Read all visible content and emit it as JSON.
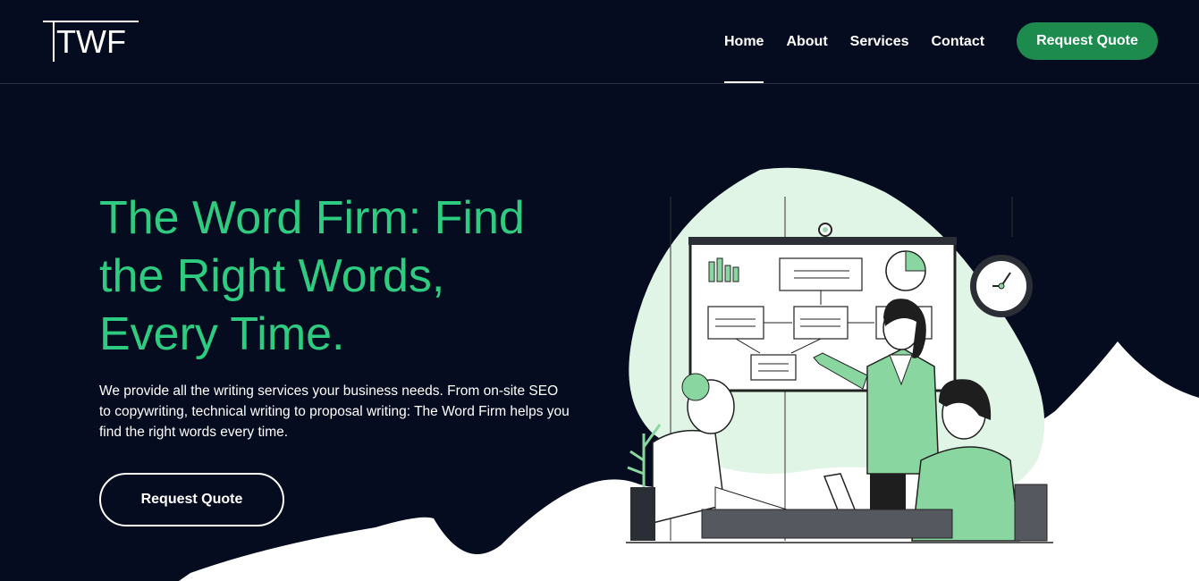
{
  "brand": {
    "logo_text": "TWF"
  },
  "nav": {
    "items": [
      {
        "label": "Home",
        "active": true
      },
      {
        "label": "About",
        "active": false
      },
      {
        "label": "Services",
        "active": false
      },
      {
        "label": "Contact",
        "active": false
      }
    ],
    "cta_label": "Request Quote"
  },
  "hero": {
    "title_lines": [
      "The Word Firm: Find",
      "the Right Words,",
      "Every Time."
    ],
    "description": "We provide all the writing services your business needs. From on-site SEO to copywriting, technical writing to proposal writing: The Word Firm helps you find the right words every time.",
    "cta_label": "Request Quote"
  },
  "illustration": {
    "icon": "team-meeting-whiteboard-illustration"
  },
  "colors": {
    "background": "#060c20",
    "accent": "#2ecc80",
    "button": "#1d8a4e",
    "mint": "#e0f5e6",
    "white": "#ffffff"
  }
}
